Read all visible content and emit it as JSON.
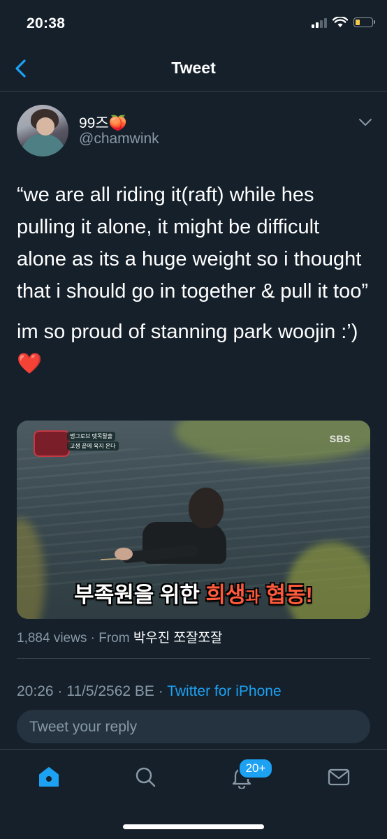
{
  "status_bar": {
    "time": "20:38"
  },
  "nav": {
    "title": "Tweet"
  },
  "author": {
    "display_name": "99즈🍑",
    "handle": "@chamwink"
  },
  "tweet": {
    "paragraph1": "“we are all riding it(raft) while hes pulling it alone, it might be difficult alone as its a huge weight so i thought that i should go in together & pull it too”",
    "paragraph2": "im so proud of stanning park woojin :’)",
    "emoji": "❤️"
  },
  "media": {
    "channel": "SBS",
    "tag_line1": "맹그로브 탯목탈출",
    "tag_line2": "고생 끝에 육지 온다",
    "caption_part1": "부족원을 위한 ",
    "caption_part2": "희생",
    "caption_part3": "과",
    "caption_part4": " 협동!"
  },
  "stats": {
    "views": "1,884 views · From ",
    "source": "박우진 쪼잘쪼잘"
  },
  "meta": {
    "timestamp": "20:26 · 11/5/2562 BE · ",
    "client": "Twitter for iPhone"
  },
  "reply": {
    "placeholder": "Tweet your reply"
  },
  "tabs": {
    "items": [
      "home-icon",
      "search-icon",
      "bell-icon",
      "mail-icon"
    ],
    "notification_badge": "20+"
  },
  "colors": {
    "background": "#15202b",
    "accent": "#1da1f2",
    "muted": "#8899a6"
  }
}
